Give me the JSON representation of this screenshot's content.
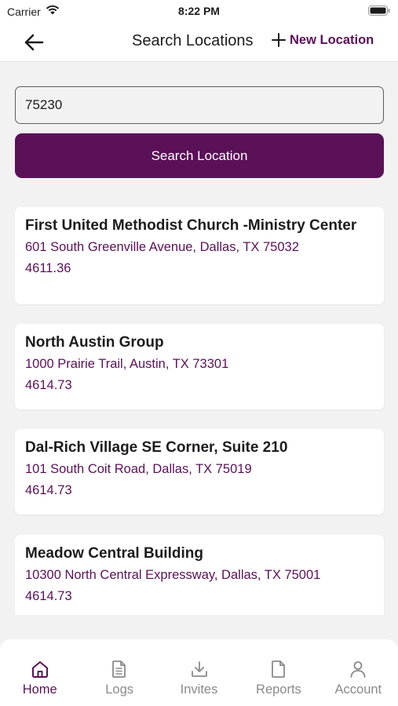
{
  "status_bar": {
    "carrier": "Carrier",
    "time": "8:22 PM"
  },
  "nav": {
    "title": "Search Locations",
    "new_location_label": "New Location"
  },
  "search": {
    "value": "75230",
    "button_label": "Search Location"
  },
  "results": [
    {
      "name": "First United Methodist Church -Ministry Center",
      "address": "601 South Greenville Avenue, Dallas, TX 75032",
      "distance": "4611.36"
    },
    {
      "name": "North Austin Group",
      "address": "1000 Prairie Trail, Austin, TX 73301",
      "distance": "4614.73"
    },
    {
      "name": "Dal-Rich Village SE Corner, Suite 210",
      "address": "101 South Coit Road, Dallas, TX 75019",
      "distance": "4614.73"
    },
    {
      "name": "Meadow Central Building",
      "address": "10300 North Central Expressway, Dallas, TX 75001",
      "distance": "4614.73"
    }
  ],
  "tabs": [
    {
      "label": "Home",
      "icon": "home-icon",
      "active": true
    },
    {
      "label": "Logs",
      "icon": "logs-icon",
      "active": false
    },
    {
      "label": "Invites",
      "icon": "download-icon",
      "active": false
    },
    {
      "label": "Reports",
      "icon": "document-icon",
      "active": false
    },
    {
      "label": "Account",
      "icon": "person-icon",
      "active": false
    }
  ],
  "colors": {
    "accent": "#5a1158",
    "background": "#f2f2f2",
    "card": "#ffffff",
    "inactive_tab": "#8a8a8a"
  }
}
